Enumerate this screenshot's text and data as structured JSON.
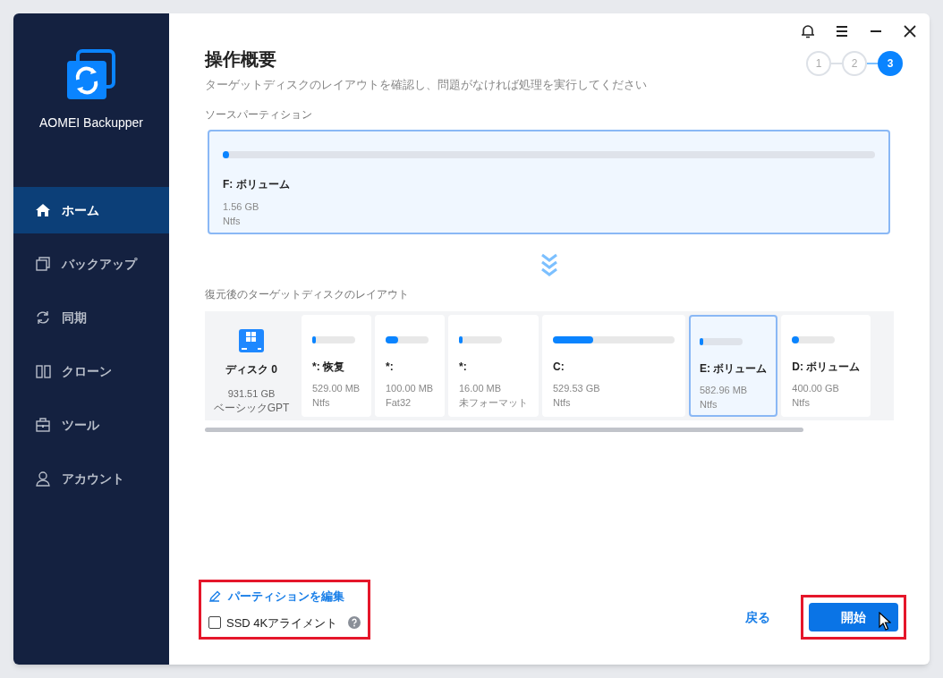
{
  "app": {
    "name": "AOMEI Backupper"
  },
  "sidebar": {
    "items": [
      {
        "label": "ホーム",
        "selected": true
      },
      {
        "label": "バックアップ",
        "selected": false
      },
      {
        "label": "同期",
        "selected": false
      },
      {
        "label": "クローン",
        "selected": false
      },
      {
        "label": "ツール",
        "selected": false
      },
      {
        "label": "アカウント",
        "selected": false
      }
    ]
  },
  "steps": [
    {
      "label": "1",
      "selected": false
    },
    {
      "label": "2",
      "selected": false
    },
    {
      "label": "3",
      "selected": true
    }
  ],
  "title": "操作概要",
  "subtitle": "ターゲットディスクのレイアウトを確認し、問題がなければ処理を実行してください",
  "source": {
    "heading": "ソースパーティション",
    "name": "F: ボリューム",
    "size": "1.56 GB",
    "fs": "Ntfs",
    "level": 0.01
  },
  "target": {
    "heading": "復元後のターゲットディスクのレイアウト",
    "disk": {
      "name": "ディスク 0",
      "size": "931.51 GB",
      "type": "ベーシックGPT"
    },
    "partitions": [
      {
        "name": "*: 恢复",
        "size": "529.00 MB",
        "fs": "Ntfs",
        "level": 0.05,
        "selected": false
      },
      {
        "name": "*:",
        "size": "100.00 MB",
        "fs": "Fat32",
        "level": 0.3,
        "selected": false
      },
      {
        "name": "*:",
        "size": "16.00 MB",
        "fs": "未フォーマット",
        "level": 0.05,
        "selected": false
      },
      {
        "name": "C:",
        "size": "529.53 GB",
        "fs": "Ntfs",
        "level": 0.33,
        "selected": false
      },
      {
        "name": "E: ボリューム",
        "size": "582.96 MB",
        "fs": "Ntfs",
        "level": 0.05,
        "selected": true
      },
      {
        "name": "D: ボリューム",
        "size": "400.00 GB",
        "fs": "Ntfs",
        "level": 0.15,
        "selected": false
      }
    ]
  },
  "edit_link": "パーティションを編集",
  "ssd_align": {
    "label": "SSD 4Kアライメント",
    "checked": false
  },
  "back_button": "戻る",
  "start_button": "開始"
}
